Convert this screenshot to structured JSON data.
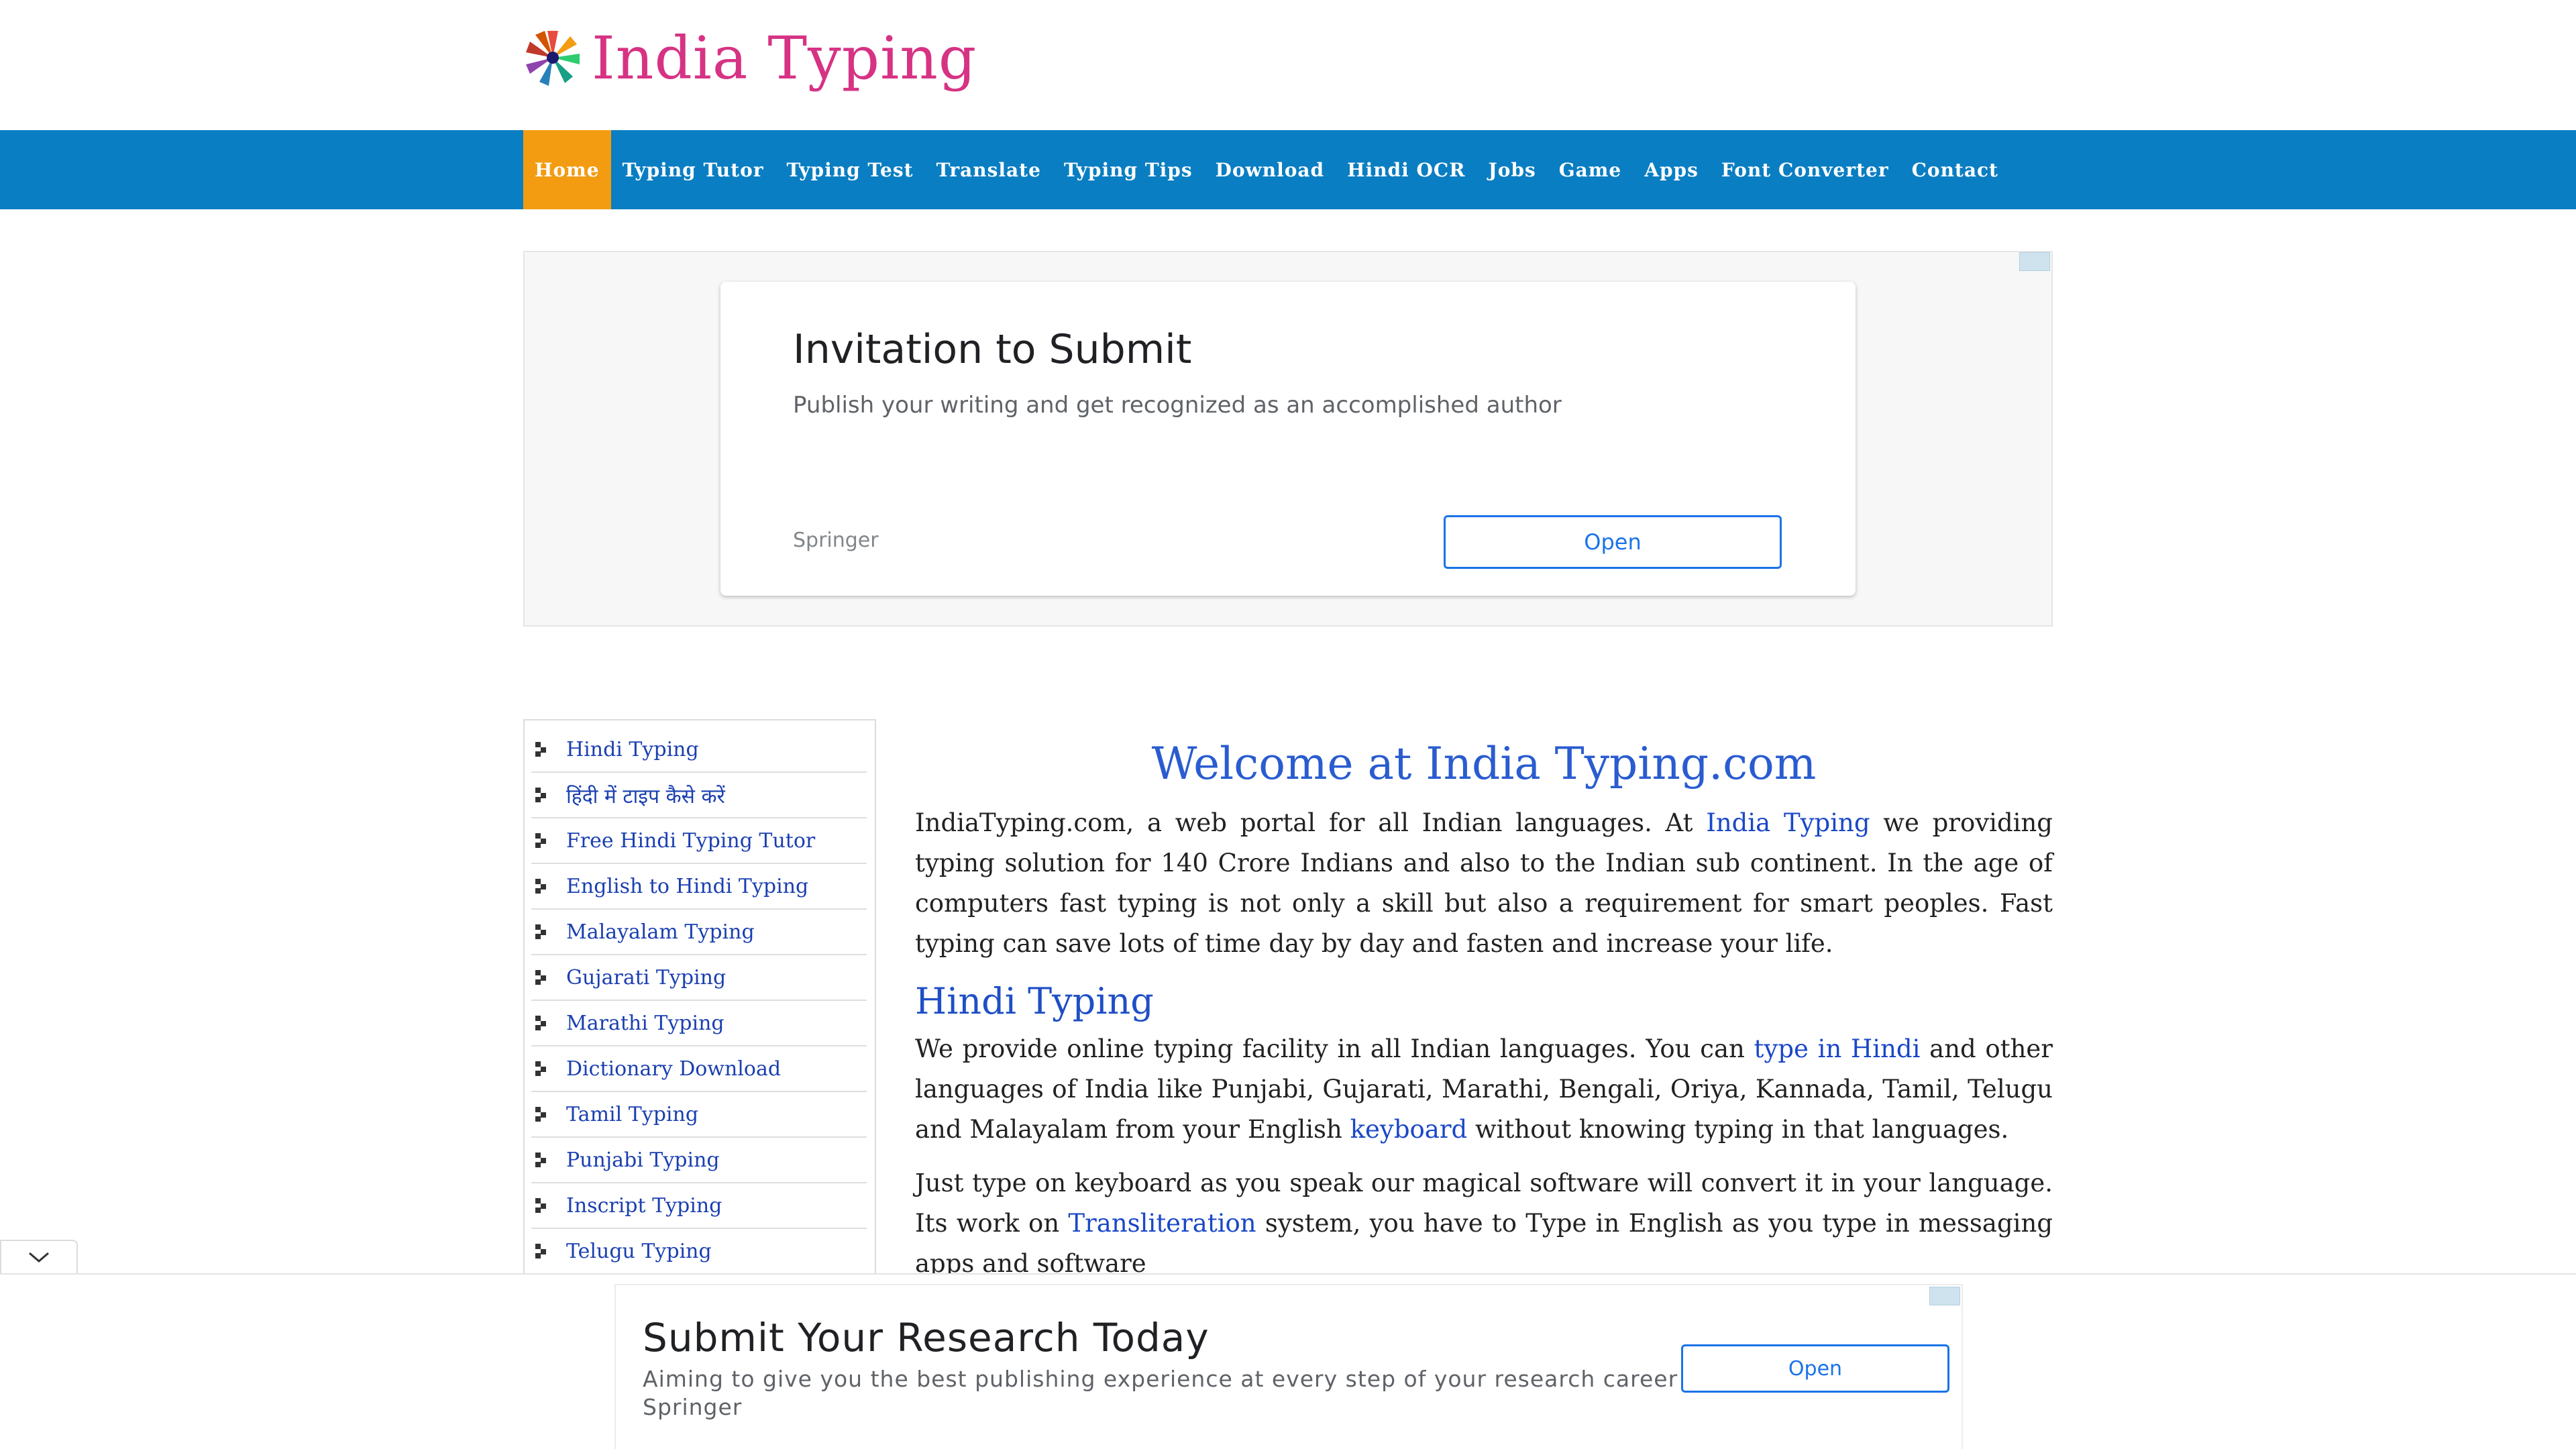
{
  "header": {
    "logo_text": "India Typing"
  },
  "nav": {
    "items": [
      {
        "label": "Home"
      },
      {
        "label": "Typing Tutor"
      },
      {
        "label": "Typing Test"
      },
      {
        "label": "Translate"
      },
      {
        "label": "Typing Tips"
      },
      {
        "label": "Download"
      },
      {
        "label": "Hindi OCR"
      },
      {
        "label": "Jobs"
      },
      {
        "label": "Game"
      },
      {
        "label": "Apps"
      },
      {
        "label": "Font Converter"
      },
      {
        "label": "Contact"
      }
    ],
    "active_color": "#f39c12",
    "bar_color": "#0a7ec2"
  },
  "ad_top": {
    "title": "Invitation to Submit",
    "subtitle": "Publish your writing and get recognized as an accomplished author",
    "brand": "Springer",
    "button": "Open"
  },
  "sidebar": {
    "items": [
      {
        "label": "Hindi Typing"
      },
      {
        "label": "हिंदी में टाइप कैसे करें"
      },
      {
        "label": "Free Hindi Typing Tutor"
      },
      {
        "label": "English to Hindi Typing"
      },
      {
        "label": "Malayalam Typing"
      },
      {
        "label": "Gujarati Typing"
      },
      {
        "label": "Marathi Typing"
      },
      {
        "label": "Dictionary Download"
      },
      {
        "label": "Tamil Typing"
      },
      {
        "label": "Punjabi Typing"
      },
      {
        "label": "Inscript Typing"
      },
      {
        "label": "Telugu Typing"
      }
    ]
  },
  "main": {
    "title": "Welcome at India Typing.com",
    "p1": {
      "before": "IndiaTyping.com, a web portal for all Indian languages. At ",
      "link": "India Typing",
      "after": " we providing typing solution for 140 Crore Indians and also to the Indian sub continent. In the age of computers fast typing is not only a skill but also a requirement for smart peoples. Fast typing can save lots of time day by day and fasten and increase your life."
    },
    "h2": "Hindi Typing",
    "p2": {
      "before": "We provide online typing facility in all Indian languages. You can ",
      "link1": "type in Hindi",
      "mid": " and other languages of India like Punjabi, Gujarati, Marathi, Bengali, Oriya, Kannada, Tamil, Telugu and Malayalam from your English ",
      "link2": "keyboard",
      "after": " without knowing typing in that languages."
    },
    "p3": {
      "before": "Just type on keyboard as you speak our magical software will convert it in your language. Its work on ",
      "link": "Transliteration",
      "after": " system, you have to Type in English as you type in messaging apps and software"
    }
  },
  "ad_bottom": {
    "title": "Submit Your Research Today",
    "subtitle": "Aiming to give you the best publishing experience at every step of your research career",
    "brand": "Springer",
    "button": "Open"
  }
}
